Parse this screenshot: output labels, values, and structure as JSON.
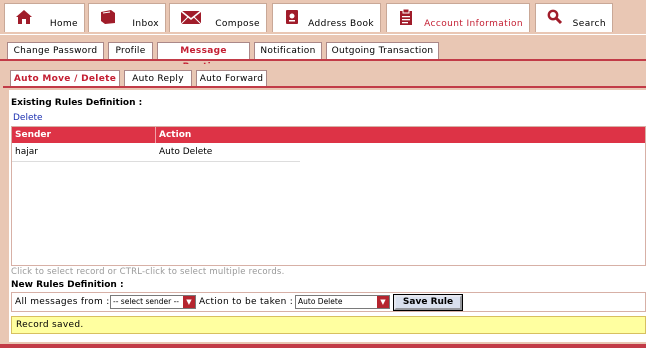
{
  "nav": {
    "tabs": [
      {
        "label": "Home",
        "icon": "home-icon"
      },
      {
        "label": "Inbox",
        "icon": "inbox-icon"
      },
      {
        "label": "Compose",
        "icon": "compose-icon"
      },
      {
        "label": "Address Book",
        "icon": "address-book-icon"
      },
      {
        "label": "Account Information",
        "icon": "account-information-icon",
        "active": true
      },
      {
        "label": "Search",
        "icon": "search-icon"
      }
    ]
  },
  "subtabs": [
    "Change Password",
    "Profile",
    "Message Routing",
    "Notification",
    "Outgoing Transaction"
  ],
  "inner_tabs": [
    "Auto Move / Delete",
    "Auto Reply",
    "Auto Forward"
  ],
  "content": {
    "existing_title": "Existing Rules Definition :",
    "delete_link": "Delete",
    "table": {
      "headers": [
        "Sender",
        "Action"
      ],
      "rows": [
        [
          "hajar",
          "Auto Delete"
        ]
      ]
    },
    "hint": "Click to select record or CTRL-click to select multiple records.",
    "new_title": "New Rules Definition :",
    "form": {
      "from_label": "All messages from :",
      "sender_value": "-- select sender --",
      "action_label": "Action to be taken :",
      "action_value": "Auto Delete",
      "save_label": "Save Rule"
    },
    "status": "Record saved."
  },
  "colors": {
    "accent": "#dd3346",
    "background": "#e9c7b4",
    "status_bg": "#ffffa0"
  }
}
